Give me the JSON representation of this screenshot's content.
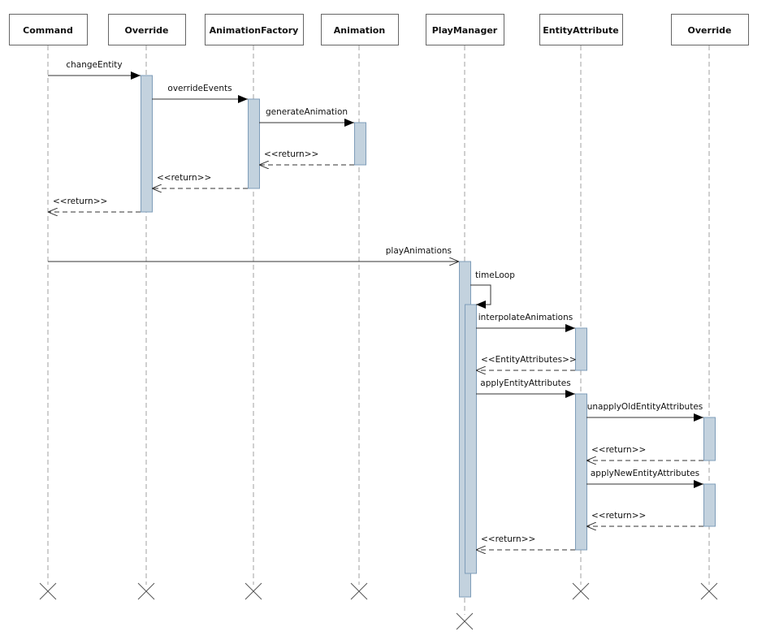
{
  "participants": [
    {
      "name": "Command"
    },
    {
      "name": "Override"
    },
    {
      "name": "AnimationFactory"
    },
    {
      "name": "Animation"
    },
    {
      "name": "PlayManager"
    },
    {
      "name": "EntityAttribute"
    },
    {
      "name": "Override"
    }
  ],
  "messages": [
    {
      "label": "changeEntity",
      "from": 0,
      "to": 1,
      "kind": "sync"
    },
    {
      "label": "overrideEvents",
      "from": 1,
      "to": 2,
      "kind": "sync"
    },
    {
      "label": "generateAnimation",
      "from": 2,
      "to": 3,
      "kind": "sync"
    },
    {
      "label": "<<return>>",
      "from": 3,
      "to": 2,
      "kind": "return"
    },
    {
      "label": "<<return>>",
      "from": 2,
      "to": 1,
      "kind": "return"
    },
    {
      "label": "<<return>>",
      "from": 1,
      "to": 0,
      "kind": "return"
    },
    {
      "label": "playAnimations",
      "from": 0,
      "to": 4,
      "kind": "async"
    },
    {
      "label": "timeLoop",
      "from": 4,
      "to": 4,
      "kind": "self"
    },
    {
      "label": "interpolateAnimations",
      "from": 4,
      "to": 5,
      "kind": "sync"
    },
    {
      "label": "<<EntityAttributes>>",
      "from": 5,
      "to": 4,
      "kind": "return"
    },
    {
      "label": "applyEntityAttributes",
      "from": 4,
      "to": 5,
      "kind": "sync"
    },
    {
      "label": "unapplyOldEntityAttributes",
      "from": 5,
      "to": 6,
      "kind": "sync"
    },
    {
      "label": "<<return>>",
      "from": 6,
      "to": 5,
      "kind": "return"
    },
    {
      "label": "applyNewEntityAttributes",
      "from": 5,
      "to": 6,
      "kind": "sync"
    },
    {
      "label": "<<return>>",
      "from": 6,
      "to": 5,
      "kind": "return"
    },
    {
      "label": "<<return>>",
      "from": 5,
      "to": 4,
      "kind": "return"
    }
  ],
  "colors": {
    "activation_fill": "#c3d2de",
    "activation_stroke": "#7f9db9",
    "lifeline": "#a0a0a0"
  }
}
